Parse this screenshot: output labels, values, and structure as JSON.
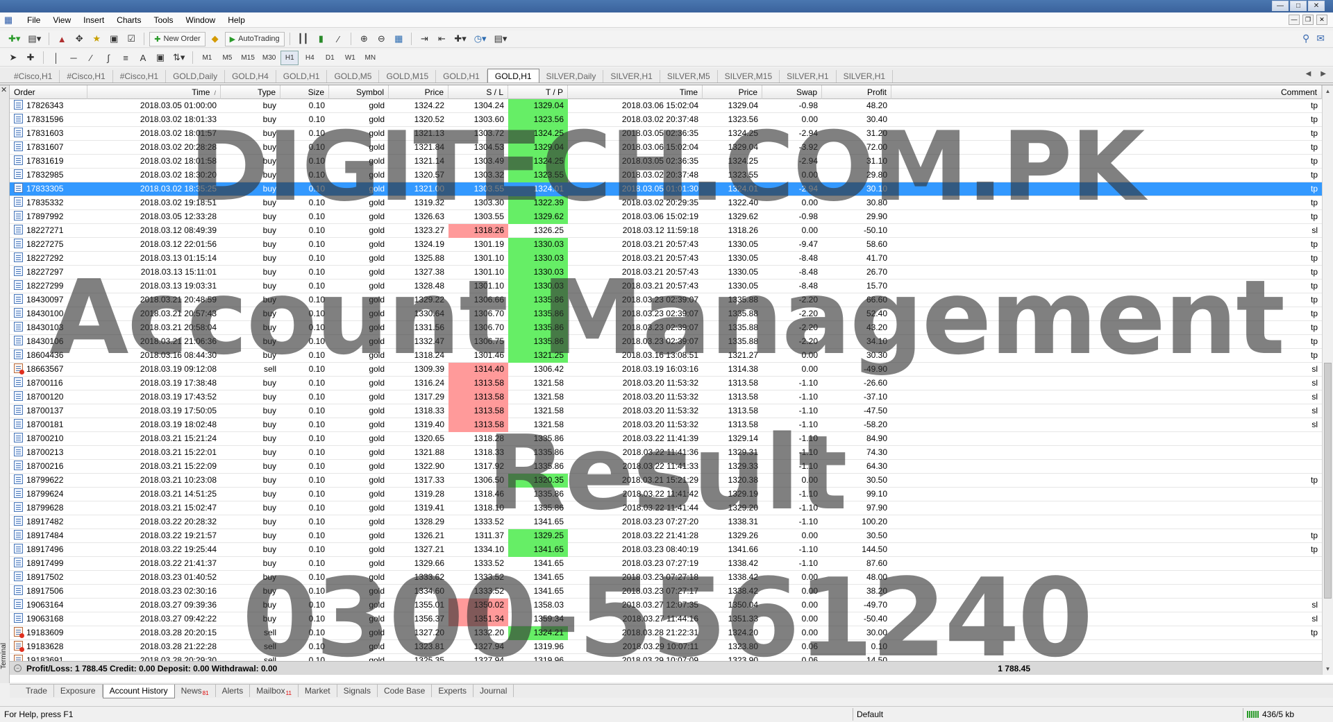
{
  "menu": [
    "File",
    "View",
    "Insert",
    "Charts",
    "Tools",
    "Window",
    "Help"
  ],
  "toolbar": {
    "new_order": "New Order",
    "autotrading": "AutoTrading",
    "timeframes": [
      "M1",
      "M5",
      "M15",
      "M30",
      "H1",
      "H4",
      "D1",
      "W1",
      "MN"
    ],
    "active_timeframe": "H1"
  },
  "chart_tabs": [
    "#Cisco,H1",
    "#Cisco,H1",
    "#Cisco,H1",
    "GOLD,Daily",
    "GOLD,H4",
    "GOLD,H1",
    "GOLD,M5",
    "GOLD,M15",
    "GOLD,H1",
    "GOLD,H1",
    "SILVER,Daily",
    "SILVER,H1",
    "SILVER,M5",
    "SILVER,M15",
    "SILVER,H1",
    "SILVER,H1"
  ],
  "active_chart_tab": 9,
  "terminal_label": "Terminal",
  "columns": [
    "Order",
    "Time",
    "Type",
    "Size",
    "Symbol",
    "Price",
    "S / L",
    "T / P",
    "Time",
    "Price",
    "Swap",
    "Profit",
    "Comment"
  ],
  "sort_indicator": "/",
  "rows": [
    [
      "17826343",
      "2018.03.05 01:00:00",
      "buy",
      "0.10",
      "gold",
      "1324.22",
      "1304.24",
      "1329.04",
      "2018.03.06 15:02:04",
      "1329.04",
      "-0.98",
      "48.20",
      "tp"
    ],
    [
      "17831596",
      "2018.03.02 18:01:33",
      "buy",
      "0.10",
      "gold",
      "1320.52",
      "1303.60",
      "1323.56",
      "2018.03.02 20:37:48",
      "1323.56",
      "0.00",
      "30.40",
      "tp"
    ],
    [
      "17831603",
      "2018.03.02 18:01:57",
      "buy",
      "0.10",
      "gold",
      "1321.13",
      "1303.72",
      "1324.25",
      "2018.03.05 02:36:35",
      "1324.25",
      "-2.94",
      "31.20",
      "tp"
    ],
    [
      "17831607",
      "2018.03.02 20:28:28",
      "buy",
      "0.10",
      "gold",
      "1321.84",
      "1304.53",
      "1329.04",
      "2018.03.06 15:02:04",
      "1329.04",
      "-3.92",
      "72.00",
      "tp"
    ],
    [
      "17831619",
      "2018.03.02 18:01:58",
      "buy",
      "0.10",
      "gold",
      "1321.14",
      "1303.49",
      "1324.25",
      "2018.03.05 02:36:35",
      "1324.25",
      "-2.94",
      "31.10",
      "tp"
    ],
    [
      "17832985",
      "2018.03.02 18:30:20",
      "buy",
      "0.10",
      "gold",
      "1320.57",
      "1303.32",
      "1323.55",
      "2018.03.02 20:37:48",
      "1323.55",
      "0.00",
      "29.80",
      "tp"
    ],
    [
      "17833305",
      "2018.03.02 18:35:25",
      "buy",
      "0.10",
      "gold",
      "1321.00",
      "1303.55",
      "1324.01",
      "2018.03.05 01:01:30",
      "1324.01",
      "-2.94",
      "30.10",
      "tp"
    ],
    [
      "17835332",
      "2018.03.02 19:18:51",
      "buy",
      "0.10",
      "gold",
      "1319.32",
      "1303.30",
      "1322.39",
      "2018.03.02 20:29:35",
      "1322.40",
      "0.00",
      "30.80",
      "tp"
    ],
    [
      "17897992",
      "2018.03.05 12:33:28",
      "buy",
      "0.10",
      "gold",
      "1326.63",
      "1303.55",
      "1329.62",
      "2018.03.06 15:02:19",
      "1329.62",
      "-0.98",
      "29.90",
      "tp"
    ],
    [
      "18227271",
      "2018.03.12 08:49:39",
      "buy",
      "0.10",
      "gold",
      "1323.27",
      "1318.26",
      "1326.25",
      "2018.03.12 11:59:18",
      "1318.26",
      "0.00",
      "-50.10",
      "sl"
    ],
    [
      "18227275",
      "2018.03.12 22:01:56",
      "buy",
      "0.10",
      "gold",
      "1324.19",
      "1301.19",
      "1330.03",
      "2018.03.21 20:57:43",
      "1330.05",
      "-9.47",
      "58.60",
      "tp"
    ],
    [
      "18227292",
      "2018.03.13 01:15:14",
      "buy",
      "0.10",
      "gold",
      "1325.88",
      "1301.10",
      "1330.03",
      "2018.03.21 20:57:43",
      "1330.05",
      "-8.48",
      "41.70",
      "tp"
    ],
    [
      "18227297",
      "2018.03.13 15:11:01",
      "buy",
      "0.10",
      "gold",
      "1327.38",
      "1301.10",
      "1330.03",
      "2018.03.21 20:57:43",
      "1330.05",
      "-8.48",
      "26.70",
      "tp"
    ],
    [
      "18227299",
      "2018.03.13 19:03:31",
      "buy",
      "0.10",
      "gold",
      "1328.48",
      "1301.10",
      "1330.03",
      "2018.03.21 20:57:43",
      "1330.05",
      "-8.48",
      "15.70",
      "tp"
    ],
    [
      "18430097",
      "2018.03.21 20:48:59",
      "buy",
      "0.10",
      "gold",
      "1329.22",
      "1306.66",
      "1335.86",
      "2018.03.23 02:39:07",
      "1335.88",
      "-2.20",
      "66.60",
      "tp"
    ],
    [
      "18430100",
      "2018.03.21 20:57:43",
      "buy",
      "0.10",
      "gold",
      "1330.64",
      "1306.70",
      "1335.86",
      "2018.03.23 02:39:07",
      "1335.88",
      "-2.20",
      "52.40",
      "tp"
    ],
    [
      "18430103",
      "2018.03.21 20:58:04",
      "buy",
      "0.10",
      "gold",
      "1331.56",
      "1306.70",
      "1335.86",
      "2018.03.23 02:39:07",
      "1335.88",
      "-2.20",
      "43.20",
      "tp"
    ],
    [
      "18430106",
      "2018.03.21 21:06:36",
      "buy",
      "0.10",
      "gold",
      "1332.47",
      "1306.75",
      "1335.86",
      "2018.03.23 02:39:07",
      "1335.88",
      "-2.20",
      "34.10",
      "tp"
    ],
    [
      "18604436",
      "2018.03.16 08:44:30",
      "buy",
      "0.10",
      "gold",
      "1318.24",
      "1301.46",
      "1321.25",
      "2018.03.16 13:08:51",
      "1321.27",
      "0.00",
      "30.30",
      "tp"
    ],
    [
      "18663567",
      "2018.03.19 09:12:08",
      "sell",
      "0.10",
      "gold",
      "1309.39",
      "1314.40",
      "1306.42",
      "2018.03.19 16:03:16",
      "1314.38",
      "0.00",
      "-49.90",
      "sl"
    ],
    [
      "18700116",
      "2018.03.19 17:38:48",
      "buy",
      "0.10",
      "gold",
      "1316.24",
      "1313.58",
      "1321.58",
      "2018.03.20 11:53:32",
      "1313.58",
      "-1.10",
      "-26.60",
      "sl"
    ],
    [
      "18700120",
      "2018.03.19 17:43:52",
      "buy",
      "0.10",
      "gold",
      "1317.29",
      "1313.58",
      "1321.58",
      "2018.03.20 11:53:32",
      "1313.58",
      "-1.10",
      "-37.10",
      "sl"
    ],
    [
      "18700137",
      "2018.03.19 17:50:05",
      "buy",
      "0.10",
      "gold",
      "1318.33",
      "1313.58",
      "1321.58",
      "2018.03.20 11:53:32",
      "1313.58",
      "-1.10",
      "-47.50",
      "sl"
    ],
    [
      "18700181",
      "2018.03.19 18:02:48",
      "buy",
      "0.10",
      "gold",
      "1319.40",
      "1313.58",
      "1321.58",
      "2018.03.20 11:53:32",
      "1313.58",
      "-1.10",
      "-58.20",
      "sl"
    ],
    [
      "18700210",
      "2018.03.21 15:21:24",
      "buy",
      "0.10",
      "gold",
      "1320.65",
      "1318.28",
      "1335.86",
      "2018.03.22 11:41:39",
      "1329.14",
      "-1.10",
      "84.90",
      ""
    ],
    [
      "18700213",
      "2018.03.21 15:22:01",
      "buy",
      "0.10",
      "gold",
      "1321.88",
      "1318.33",
      "1335.86",
      "2018.03.22 11:41:36",
      "1329.31",
      "-1.10",
      "74.30",
      ""
    ],
    [
      "18700216",
      "2018.03.21 15:22:09",
      "buy",
      "0.10",
      "gold",
      "1322.90",
      "1317.92",
      "1335.86",
      "2018.03.22 11:41:33",
      "1329.33",
      "-1.10",
      "64.30",
      ""
    ],
    [
      "18799622",
      "2018.03.21 10:23:08",
      "buy",
      "0.10",
      "gold",
      "1317.33",
      "1306.50",
      "1320.35",
      "2018.03.21 15:21:29",
      "1320.38",
      "0.00",
      "30.50",
      "tp"
    ],
    [
      "18799624",
      "2018.03.21 14:51:25",
      "buy",
      "0.10",
      "gold",
      "1319.28",
      "1318.46",
      "1335.86",
      "2018.03.22 11:41:42",
      "1329.19",
      "-1.10",
      "99.10",
      ""
    ],
    [
      "18799628",
      "2018.03.21 15:02:47",
      "buy",
      "0.10",
      "gold",
      "1319.41",
      "1318.10",
      "1335.86",
      "2018.03.22 11:41:44",
      "1329.20",
      "-1.10",
      "97.90",
      ""
    ],
    [
      "18917482",
      "2018.03.22 20:28:32",
      "buy",
      "0.10",
      "gold",
      "1328.29",
      "1333.52",
      "1341.65",
      "2018.03.23 07:27:20",
      "1338.31",
      "-1.10",
      "100.20",
      ""
    ],
    [
      "18917484",
      "2018.03.22 19:21:57",
      "buy",
      "0.10",
      "gold",
      "1326.21",
      "1311.37",
      "1329.25",
      "2018.03.22 21:41:28",
      "1329.26",
      "0.00",
      "30.50",
      "tp"
    ],
    [
      "18917496",
      "2018.03.22 19:25:44",
      "buy",
      "0.10",
      "gold",
      "1327.21",
      "1334.10",
      "1341.65",
      "2018.03.23 08:40:19",
      "1341.66",
      "-1.10",
      "144.50",
      "tp"
    ],
    [
      "18917499",
      "2018.03.22 21:41:37",
      "buy",
      "0.10",
      "gold",
      "1329.66",
      "1333.52",
      "1341.65",
      "2018.03.23 07:27:19",
      "1338.42",
      "-1.10",
      "87.60",
      ""
    ],
    [
      "18917502",
      "2018.03.23 01:40:52",
      "buy",
      "0.10",
      "gold",
      "1333.62",
      "1333.52",
      "1341.65",
      "2018.03.23 07:27:18",
      "1338.42",
      "0.00",
      "48.00",
      ""
    ],
    [
      "18917506",
      "2018.03.23 02:30:16",
      "buy",
      "0.10",
      "gold",
      "1334.60",
      "1333.52",
      "1341.65",
      "2018.03.23 07:27:17",
      "1338.42",
      "0.00",
      "38.20",
      ""
    ],
    [
      "19063164",
      "2018.03.27 09:39:36",
      "buy",
      "0.10",
      "gold",
      "1355.01",
      "1350.02",
      "1358.03",
      "2018.03.27 12:07:35",
      "1350.04",
      "0.00",
      "-49.70",
      "sl"
    ],
    [
      "19063168",
      "2018.03.27 09:42:22",
      "buy",
      "0.10",
      "gold",
      "1356.37",
      "1351.34",
      "1359.34",
      "2018.03.27 11:44:16",
      "1351.33",
      "0.00",
      "-50.40",
      "sl"
    ],
    [
      "19183609",
      "2018.03.28 20:20:15",
      "sell",
      "0.10",
      "gold",
      "1327.20",
      "1332.20",
      "1324.21",
      "2018.03.28 21:22:31",
      "1324.20",
      "0.00",
      "30.00",
      "tp"
    ],
    [
      "19183628",
      "2018.03.28 21:22:28",
      "sell",
      "0.10",
      "gold",
      "1323.81",
      "1327.94",
      "1319.96",
      "2018.03.29 10:07:11",
      "1323.80",
      "0.06",
      "0.10",
      ""
    ],
    [
      "19183691",
      "2018.03.28 20:29:30",
      "sell",
      "0.10",
      "gold",
      "1325.35",
      "1327.94",
      "1319.96",
      "2018.03.29 10:07:09",
      "1323.90",
      "0.06",
      "14.50",
      ""
    ]
  ],
  "selected_row": 6,
  "summary": {
    "text": "Profit/Loss: 1 788.45  Credit: 0.00  Deposit: 0.00  Withdrawal: 0.00",
    "profit": "1 788.45"
  },
  "bottom_tabs": [
    {
      "label": "Trade",
      "badge": ""
    },
    {
      "label": "Exposure",
      "badge": ""
    },
    {
      "label": "Account History",
      "badge": ""
    },
    {
      "label": "News",
      "badge": "81"
    },
    {
      "label": "Alerts",
      "badge": ""
    },
    {
      "label": "Mailbox",
      "badge": "11"
    },
    {
      "label": "Market",
      "badge": ""
    },
    {
      "label": "Signals",
      "badge": ""
    },
    {
      "label": "Code Base",
      "badge": ""
    },
    {
      "label": "Experts",
      "badge": ""
    },
    {
      "label": "Journal",
      "badge": ""
    }
  ],
  "active_bottom_tab": 2,
  "status": {
    "help": "For Help, press F1",
    "profile": "Default",
    "traffic": "436/5 kb"
  },
  "watermark": [
    "DIGITECH.COM.PK",
    "Account Management",
    "Result",
    "0300-5561240"
  ],
  "colors": {
    "selection": "#3399ff",
    "tp_highlight": "#66ee66",
    "sl_highlight": "#ff9a9a"
  }
}
